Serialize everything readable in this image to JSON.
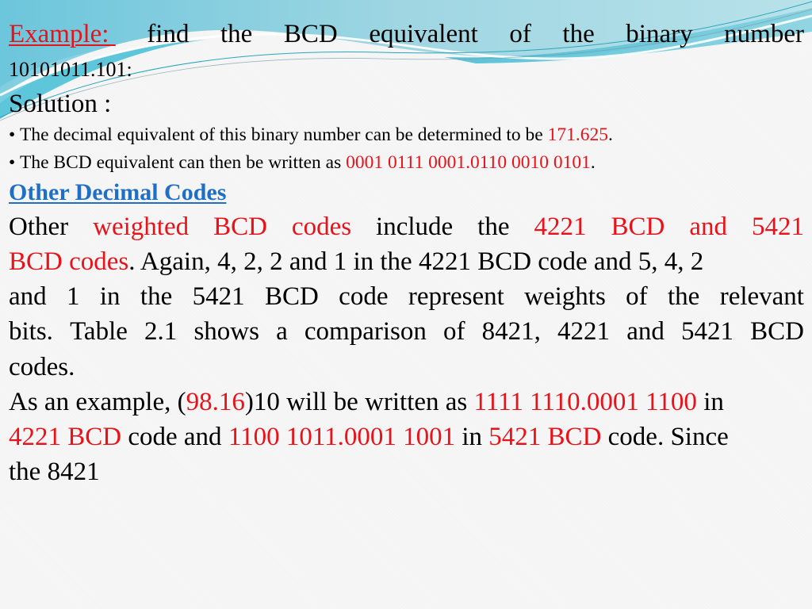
{
  "slide": {
    "example": {
      "label": "Example: ",
      "words": [
        "find",
        "the",
        "BCD",
        "equivalent",
        "of",
        "the",
        "binary",
        "number"
      ],
      "binary_number": "10101011.101:"
    },
    "solution_label": "Solution :",
    "bullets": [
      {
        "marker": "•",
        "text": "The decimal equivalent of this binary number can be determined to be ",
        "highlight": "171.625",
        "suffix": "."
      },
      {
        "marker": "•",
        "text": "The BCD equivalent can then be written as ",
        "highlight": "0001 0111 0001.0110 0010 0101",
        "suffix": "."
      }
    ],
    "section_heading": "Other Decimal Codes",
    "paragraph": {
      "line1": {
        "w1": "Other",
        "w2": "weighted",
        "w3": "BCD",
        "w4": "codes",
        "w5": "include",
        "w6": "the",
        "w7": "4221",
        "w8": "BCD",
        "w9": "and",
        "w10": "5421"
      },
      "line2": {
        "red": "BCD codes",
        "rest": ". Again, 4, 2, 2 and 1 in the 4221 BCD code and 5, 4, 2"
      },
      "line3": [
        "and",
        "1",
        "in",
        "the",
        "5421",
        "BCD",
        "code",
        "represent",
        "weights",
        "of",
        "the",
        "relevant"
      ],
      "line4": [
        "bits.",
        "Table",
        "2.1",
        "shows",
        "a",
        "comparison",
        "of",
        "8421,",
        "4221",
        "and",
        "5421",
        "BCD"
      ],
      "line5": "codes.",
      "line6": {
        "a": "As an example, (",
        "b": "98.16",
        "c": ")10 will be written as ",
        "d": "1111 1110.0001 1100",
        "e": " in"
      },
      "line7": {
        "a": "4221 BCD",
        "b": " code and ",
        "c": "1100 1011.0001 1001",
        "d": " in ",
        "e": "5421 BCD",
        "f": " code. Since"
      },
      "line8": "the 8421"
    }
  },
  "colors": {
    "accent_red": "#e8131a",
    "heading_blue": "#1f6fc5",
    "swoosh_teal": "#5cc4d8",
    "swoosh_light": "#a8dde6"
  }
}
